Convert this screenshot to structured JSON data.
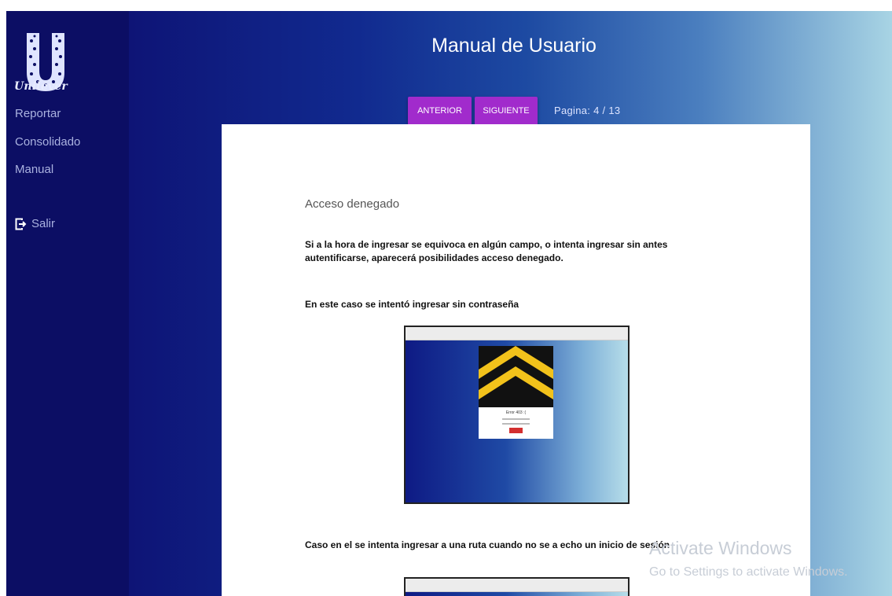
{
  "sidebar": {
    "brand": "Unilever",
    "items": [
      {
        "label": "Reportar"
      },
      {
        "label": "Consolidado"
      },
      {
        "label": "Manual"
      }
    ],
    "logout": {
      "label": "Salir",
      "icon": "logout-icon"
    }
  },
  "header": {
    "title": "Manual de Usuario",
    "prev_label": "ANTERIOR",
    "next_label": "SIGUIENTE",
    "page_info": "Pagina: 4 / 13"
  },
  "document": {
    "heading": "Acceso denegado",
    "paragraph1": "Si a la hora de ingresar se equivoca en algún campo, o intenta ingresar sin antes autentificarse, aparecerá posibilidades acceso denegado.",
    "paragraph2": "En este caso se intentó ingresar sin contraseña",
    "paragraph3": "Caso en el se intenta ingresar a una ruta cuando no se a echo un inicio de sesión"
  },
  "screenshot": {
    "error_title": "Error 403 :("
  },
  "watermark": {
    "line1": "Activate Windows",
    "line2": "Go to Settings to activate Windows."
  },
  "colors": {
    "sidebar": "#0c0e64",
    "button": "#a12bcc",
    "gradient_start": "#0e1476",
    "gradient_end": "#a8d4e4"
  }
}
